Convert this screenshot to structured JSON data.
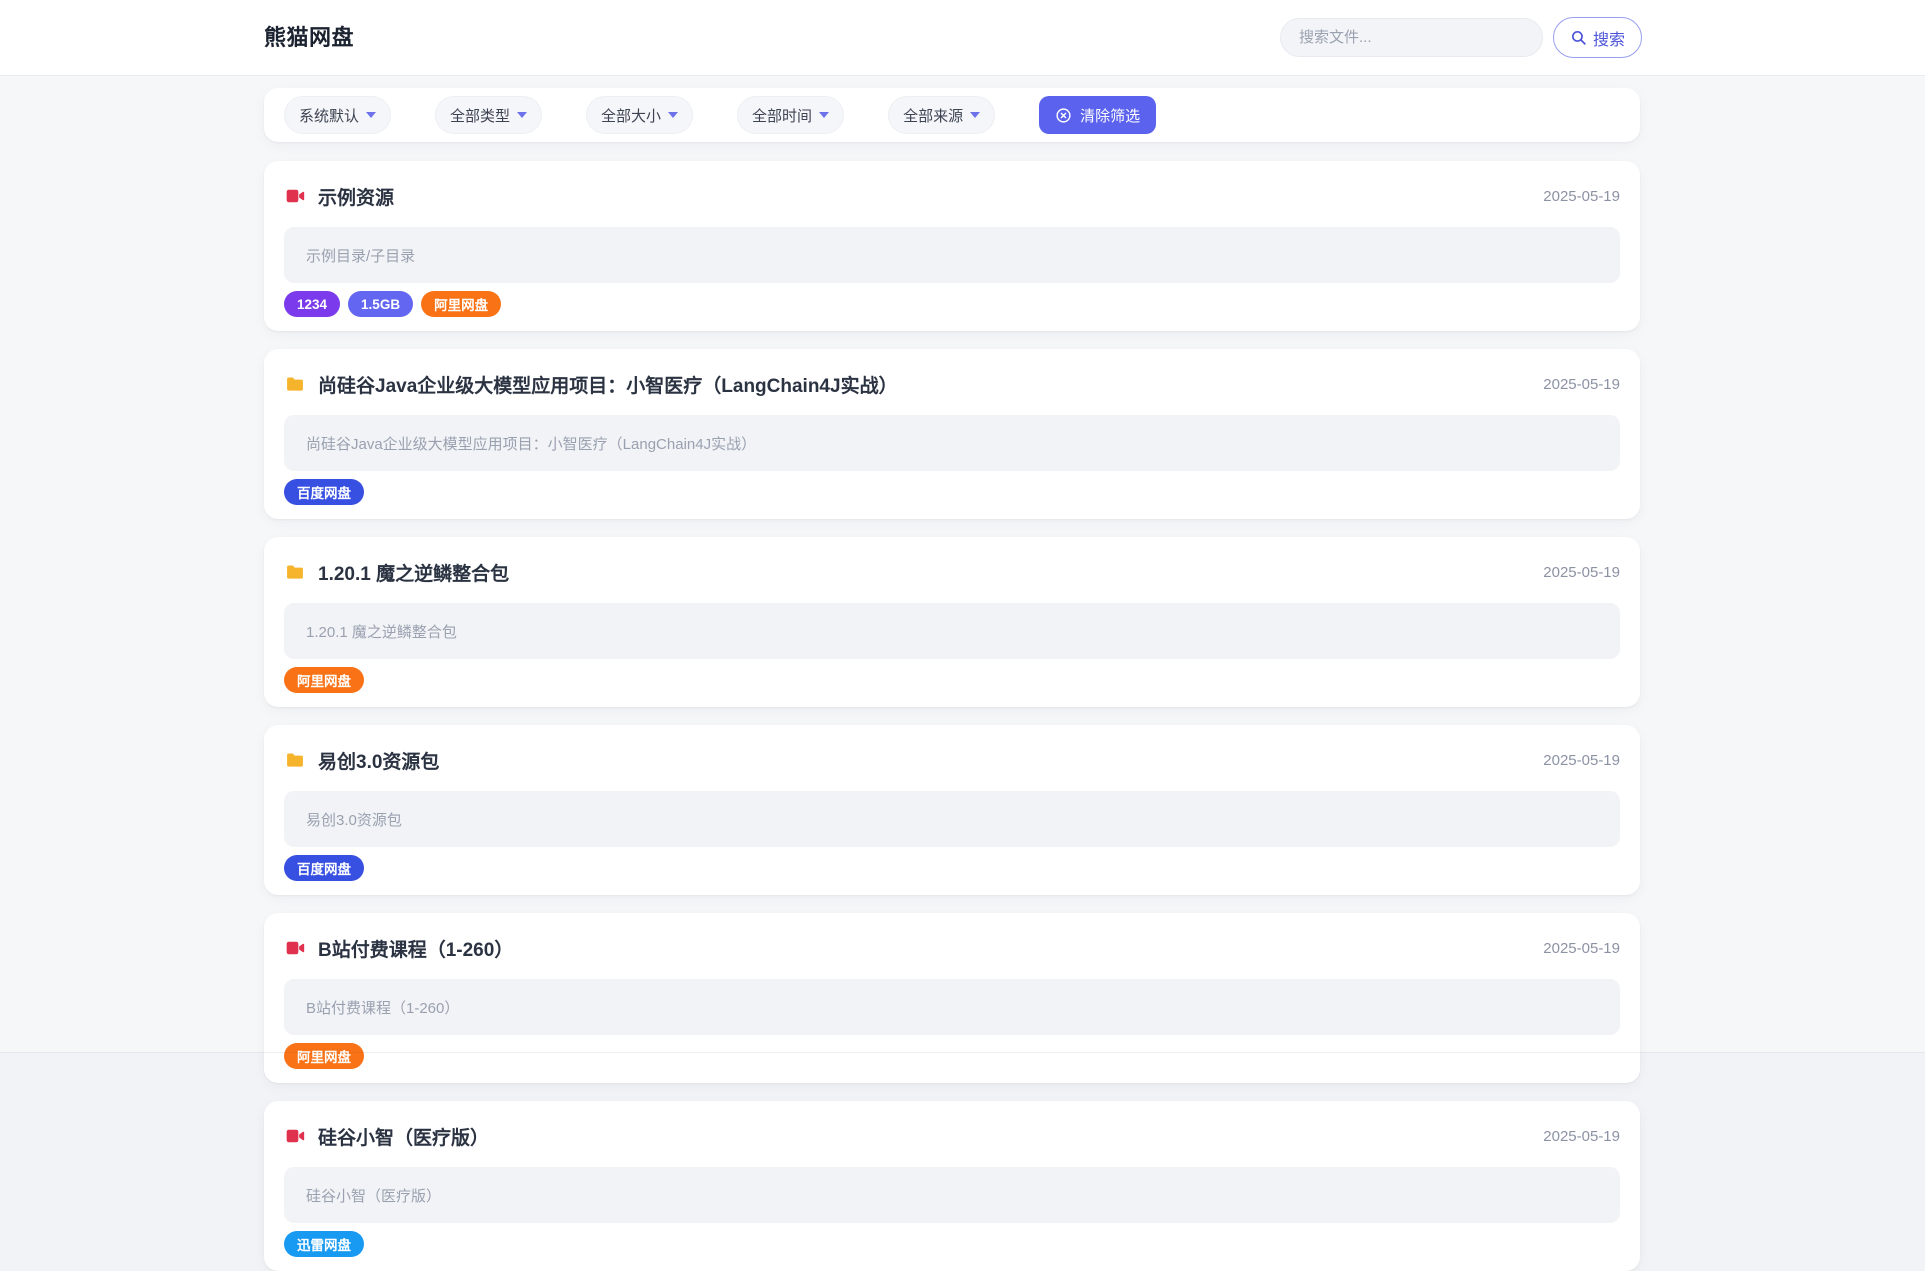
{
  "header": {
    "logo": "熊猫网盘",
    "search": {
      "placeholder": "搜索文件...",
      "button_label": "搜索"
    }
  },
  "filters": {
    "dropdowns": [
      {
        "label": "系统默认"
      },
      {
        "label": "全部类型"
      },
      {
        "label": "全部大小"
      },
      {
        "label": "全部时间"
      },
      {
        "label": "全部来源"
      }
    ],
    "clear_label": "清除筛选"
  },
  "results": [
    {
      "icon": "video",
      "title": "示例资源",
      "date": "2025-05-19",
      "description": "示例目录/子目录",
      "badges": [
        {
          "label": "1234",
          "color": "#7c3aed"
        },
        {
          "label": "1.5GB",
          "color": "#6366f1"
        },
        {
          "label": "阿里网盘",
          "color": "#f97316"
        }
      ]
    },
    {
      "icon": "folder",
      "title": "尚硅谷Java企业级大模型应用项目：小智医疗（LangChain4J实战）",
      "date": "2025-05-19",
      "description": "尚硅谷Java企业级大模型应用项目：小智医疗（LangChain4J实战）",
      "badges": [
        {
          "label": "百度网盘",
          "color": "#3750e2"
        }
      ]
    },
    {
      "icon": "folder",
      "title": "1.20.1 魔之逆鳞整合包",
      "date": "2025-05-19",
      "description": "1.20.1 魔之逆鳞整合包",
      "badges": [
        {
          "label": "阿里网盘",
          "color": "#f97316"
        }
      ]
    },
    {
      "icon": "folder",
      "title": "易创3.0资源包",
      "date": "2025-05-19",
      "description": "易创3.0资源包",
      "badges": [
        {
          "label": "百度网盘",
          "color": "#3750e2"
        }
      ]
    },
    {
      "icon": "video",
      "title": "B站付费课程（1-260）",
      "date": "2025-05-19",
      "description": "B站付费课程（1-260）",
      "badges": [
        {
          "label": "阿里网盘",
          "color": "#f97316"
        }
      ]
    },
    {
      "icon": "video",
      "title": "硅谷小智（医疗版）",
      "date": "2025-05-19",
      "description": "硅谷小智（医疗版）",
      "badges": [
        {
          "label": "迅雷网盘",
          "color": "#189af2"
        }
      ]
    }
  ],
  "colors": {
    "accent": "#5b63ee",
    "search_button": "#4d54d8",
    "video_icon": "#e0314e",
    "folder_icon": "#f6b42c"
  }
}
